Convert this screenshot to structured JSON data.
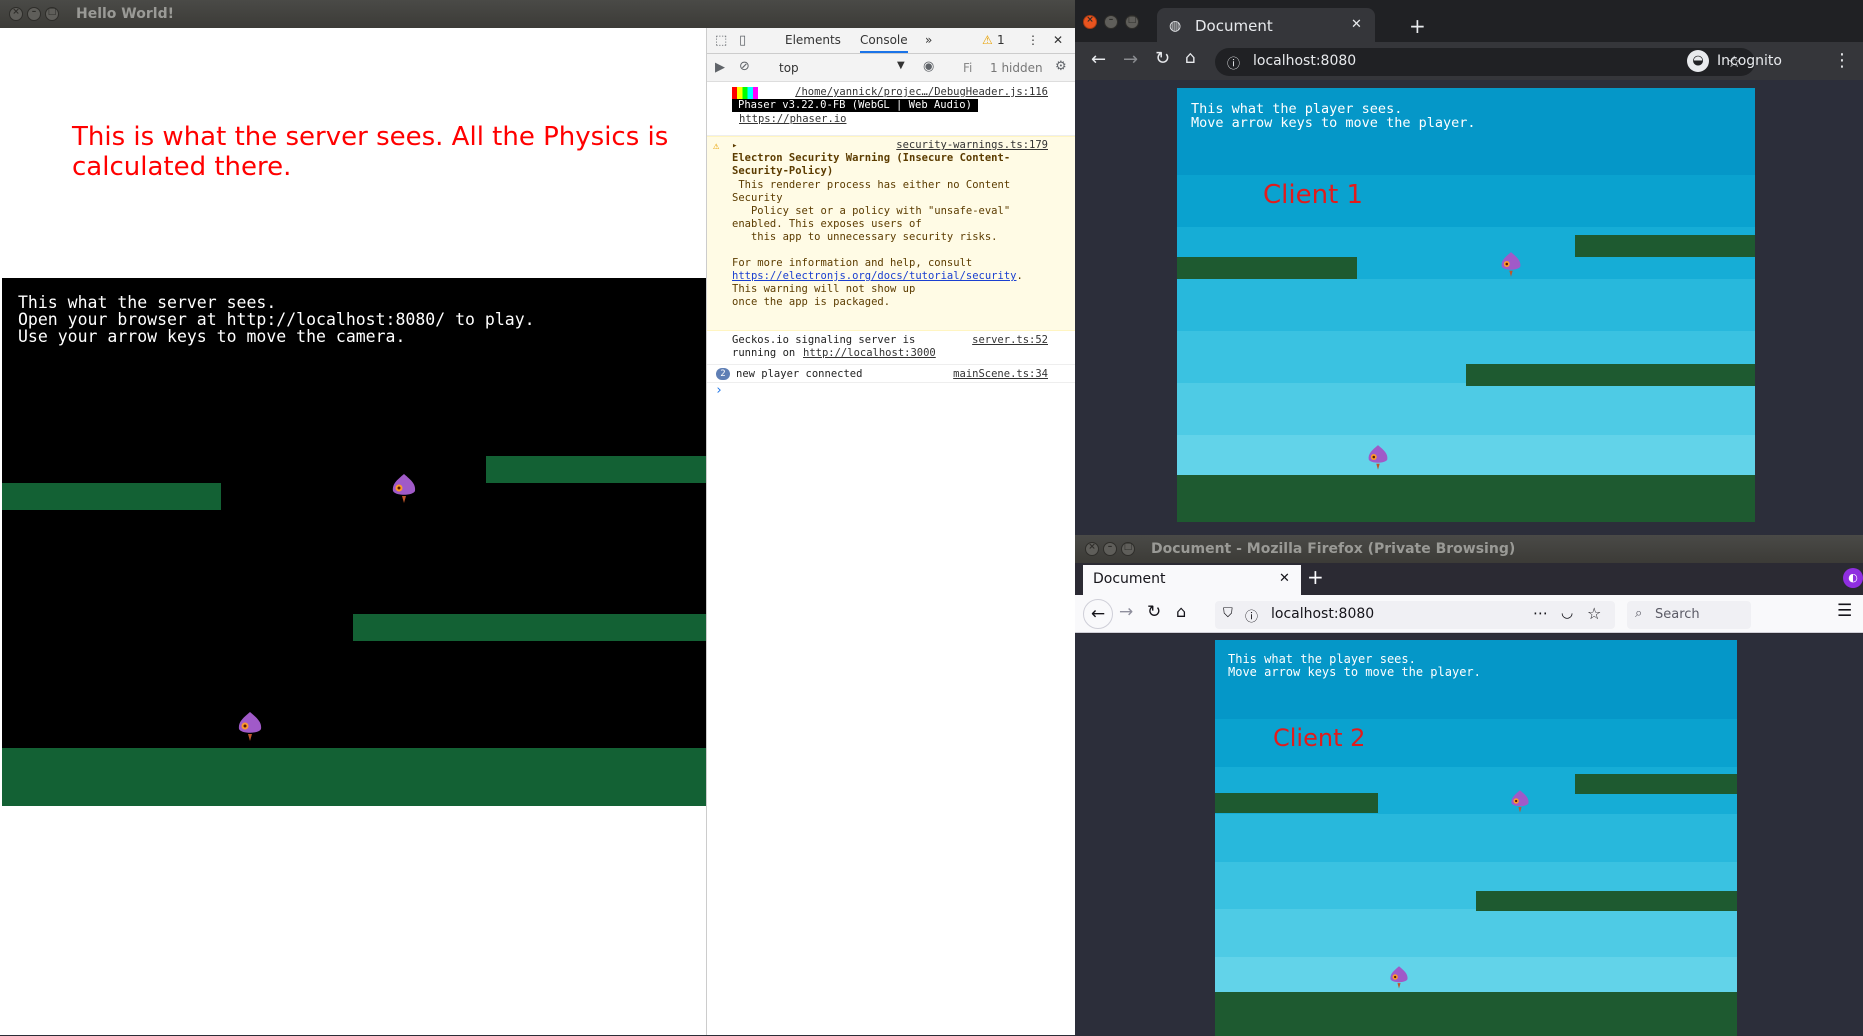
{
  "server_window": {
    "title": "Hello World!",
    "heading": "This is what the server sees. All the Physics is calculated there.",
    "game_info": "This what the server sees.\nOpen your browser at http://localhost:8080/ to play.\nUse your arrow keys to move the camera."
  },
  "devtools": {
    "tabs": [
      "Elements",
      "Console"
    ],
    "more_tabs": "»",
    "warning_count": "1",
    "context": "top",
    "filter_placeholder": "Fi",
    "hidden_count": "1 hidden",
    "logs": {
      "phaser": {
        "source": "/home/yannick/projec…/DebugHeader.js:116",
        "banner": "Phaser v3.22.0-FB (WebGL | Web Audio)",
        "link": "https://phaser.io"
      },
      "security": {
        "source": "security-warnings.ts:179",
        "title": "Electron Security Warning (Insecure Content-Security-Policy)",
        "body": " This renderer process has either no Content Security\n   Policy set or a policy with \"unsafe-eval\"\nenabled. This exposes users of\n   this app to unnecessary security risks.",
        "more_info": "For more information and help, consult",
        "link": "https://electronjs.org/docs/tutorial/security",
        "link_suffix": ".",
        "footer": "This warning will not show up\nonce the app is packaged."
      },
      "geckos": {
        "text": "Geckos.io signaling server is\nrunning on",
        "link": "http://localhost:3000",
        "source": "server.ts:52"
      },
      "player": {
        "count": "2",
        "text": "new player connected",
        "source": "mainScene.ts:34"
      },
      "prompt": "›"
    }
  },
  "chrome_window": {
    "tab_title": "Document",
    "url": "localhost:8080",
    "profile": "Incognito",
    "client_label": "Client 1",
    "game_info": "This what the player sees.\nMove arrow keys to move the player."
  },
  "firefox_window": {
    "title": "Document - Mozilla Firefox (Private Browsing)",
    "tab_title": "Document",
    "url": "localhost:8080",
    "search_placeholder": "Search",
    "client_label": "Client 2",
    "game_info": "This what the player sees.\nMove arrow keys to move the player."
  },
  "colors": {
    "server_bg": "#000000",
    "platform": "#136134",
    "sky_top": "#0595c7",
    "sky_bottom": "#6ad0ea",
    "label_red": "#e21b1b",
    "sprite": "#a05ac8"
  },
  "icons": [
    "close-icon",
    "minimize-icon",
    "maximize-icon",
    "inspect-icon",
    "device-icon",
    "kebab-icon",
    "clear-console-icon",
    "eye-icon",
    "gear-icon",
    "back-icon",
    "forward-icon",
    "reload-icon",
    "home-icon",
    "info-icon",
    "star-icon",
    "incognito-icon",
    "shield-icon",
    "pocket-icon",
    "library-icon",
    "menu-icon",
    "private-mask-icon",
    "sprite-icon"
  ]
}
